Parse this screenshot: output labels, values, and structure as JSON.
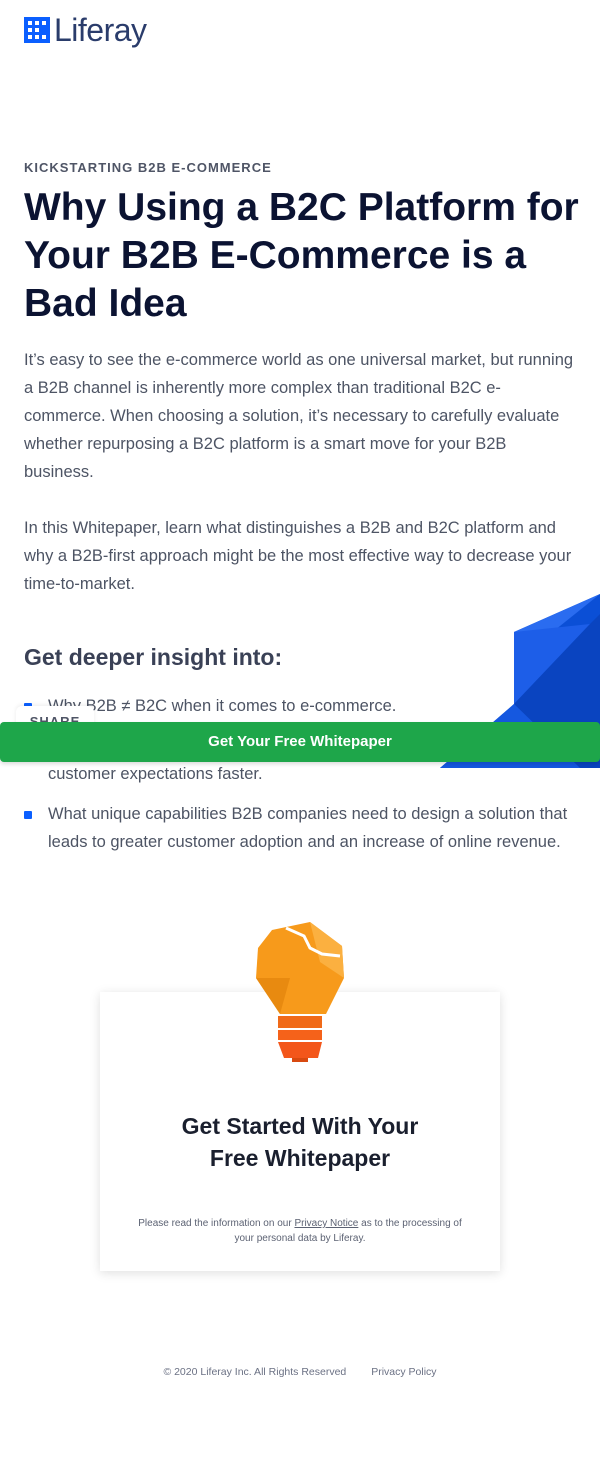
{
  "brand": {
    "name": "Liferay",
    "accent_color": "#0b5fff",
    "cta_color": "#1ea64a"
  },
  "hero": {
    "eyebrow": "KICKSTARTING B2B E-COMMERCE",
    "title": "Why Using a B2C Platform for Your B2B E-Commerce is a Bad Idea",
    "paragraphs": [
      "It’s easy to see the e-commerce world as one universal market, but running a B2B channel is inherently more complex than traditional B2C e-commerce. When choosing a solution, it’s necessary to carefully evaluate whether repurposing a B2C platform is a smart move for your B2B business.",
      "In this Whitepaper, learn what distinguishes a B2B and B2C platform and why a B2B-first approach might be the most effective way to decrease your time-to-market."
    ]
  },
  "insights": {
    "title": "Get deeper insight into:",
    "items": [
      "Why B2B ≠ B2C when it comes to e-commerce.",
      "How B2B-first solutions help businesses get to market and meet customer expectations faster.",
      "What unique capabilities B2B companies need to design a solution that leads to greater customer adoption and an increase of online revenue."
    ]
  },
  "share": {
    "label": "SHARE"
  },
  "cta_bar": {
    "label": "Get Your Free Whitepaper"
  },
  "form_card": {
    "title_line1": "Get Started With Your",
    "title_line2": "Free Whitepaper",
    "note_prefix": "Please read the information on our ",
    "note_link": "Privacy Notice",
    "note_suffix": " as to the processing of your personal data by Liferay.",
    "icon": "lightbulb-icon"
  },
  "footer": {
    "copyright": "© 2020 Liferay Inc. All Rights Reserved",
    "privacy_link": "Privacy Policy"
  }
}
